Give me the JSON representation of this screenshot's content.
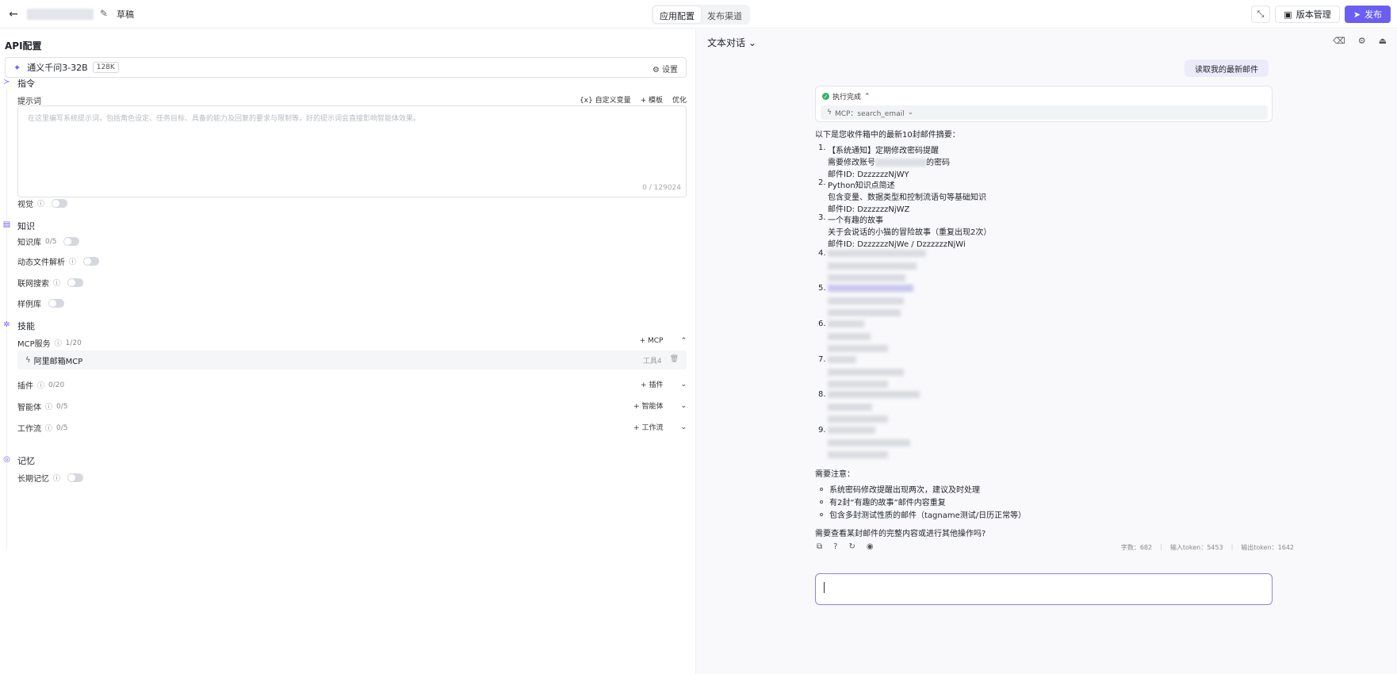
{
  "header": {
    "back_icon": "arrow-left-icon",
    "draft_label": "草稿",
    "tabs": [
      {
        "label": "应用配置",
        "active": true
      },
      {
        "label": "发布渠道",
        "active": false
      }
    ],
    "version_label": "版本管理",
    "publish_label": "发布",
    "accent_color": "#6b5ff2"
  },
  "left": {
    "api_title": "API配置",
    "model": {
      "name": "通义千问3-32B",
      "context": "128K",
      "settings_label": "设置"
    },
    "instructions": {
      "title": "指令",
      "prompt_label": "提示词",
      "tools": [
        "{x} 自定义变量",
        "+ 模板",
        "优化"
      ],
      "placeholder": "在这里编写系统提示词，包括角色设定、任务目标、具备的能力及回复的要求与限制等，好的提示词会直接影响智能体效果。",
      "counter": "0 / 129024"
    },
    "vision_label": "视觉",
    "knowledge": {
      "title": "知识",
      "items": [
        {
          "label": "知识库",
          "count": "0/5"
        },
        {
          "label": "动态文件解析"
        },
        {
          "label": "联网搜索"
        },
        {
          "label": "样例库"
        }
      ]
    },
    "skills": {
      "title": "技能",
      "mcp": {
        "label": "MCP服务",
        "count": "1/20",
        "add_label": "MCP"
      },
      "mcp_item": {
        "name": "阿里邮箱MCP",
        "tools": "工具4"
      },
      "plugins": {
        "label": "插件",
        "count": "0/20",
        "add_label": "插件"
      },
      "agents": {
        "label": "智能体",
        "count": "0/5",
        "add_label": "智能体"
      },
      "workflows": {
        "label": "工作流",
        "count": "0/5",
        "add_label": "工作流"
      }
    },
    "memory": {
      "title": "记忆",
      "long_term_label": "长期记忆"
    }
  },
  "right": {
    "chat_mode": "文本对话",
    "user_message": "读取我的最新邮件",
    "exec_status": "执行完成",
    "exec_tool": "MCP：search_email",
    "intro": "以下是您收件箱中的最新10封邮件摘要：",
    "emails": [
      {
        "num": "1.",
        "title": "【系统通知】定期修改密码提醒",
        "desc_prefix": "需要修改账号",
        "desc_suffix": "的密码",
        "id": "邮件ID: DzzzzzzNjWY"
      },
      {
        "num": "2.",
        "title": "Python知识点简述",
        "desc": "包含变量、数据类型和控制流语句等基础知识",
        "id": "邮件ID: DzzzzzzNjWZ"
      },
      {
        "num": "3.",
        "title": "一个有趣的故事",
        "desc": "关于会说话的小猫的冒险故事（重复出现2次）",
        "id": "邮件ID: DzzzzzzNjWe / DzzzzzzNjWi"
      }
    ],
    "blurred_nums": [
      "4.",
      "5.",
      "6.",
      "7.",
      "8.",
      "9."
    ],
    "notes_title": "需要注意：",
    "notes": [
      "系统密码修改提醒出现两次，建议及时处理",
      "有2封“有趣的故事”邮件内容重复",
      "包含多封测试性质的邮件（tagname测试/日历正常等）"
    ],
    "question": "需要查看某封邮件的完整内容或进行其他操作吗?",
    "tokens": {
      "chars": "字数：682",
      "input": "输入token：5453",
      "output": "输出token：1642"
    }
  }
}
